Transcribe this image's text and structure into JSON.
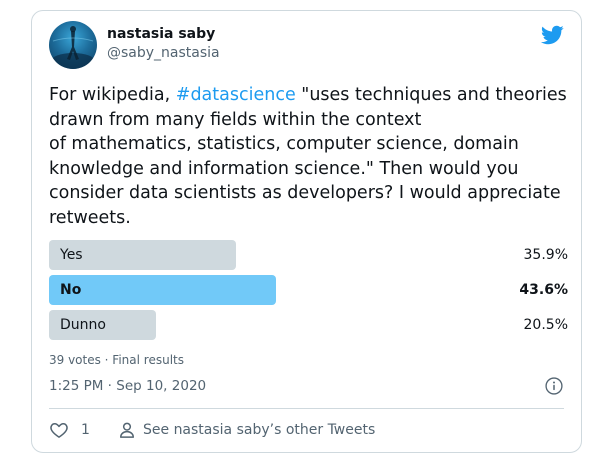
{
  "tweet": {
    "author": {
      "display_name": "nastasia saby",
      "handle": "@saby_nastasia"
    },
    "text_parts": {
      "before": "For wikipedia, ",
      "hashtag": "#datascience",
      "line1_rest": " \"uses techniques and theories",
      "line2": "drawn from many fields within the context",
      "line3": "of mathematics, statistics, computer science, domain",
      "line4": "knowledge and information science.\" Then would you",
      "line5": "consider data scientists as developers? I would appreciate",
      "line6": "retweets."
    },
    "poll": {
      "options": [
        {
          "label": "Yes",
          "percent_text": "35.9%",
          "percent": 35.9,
          "winner": false
        },
        {
          "label": "No",
          "percent_text": "43.6%",
          "percent": 43.6,
          "winner": true
        },
        {
          "label": "Dunno",
          "percent_text": "20.5%",
          "percent": 20.5,
          "winner": false
        }
      ],
      "meta": "39 votes · Final results"
    },
    "timestamp": "1:25 PM · Sep 10, 2020",
    "like_count": "1",
    "see_more_label": "See nastasia saby’s other Tweets"
  },
  "colors": {
    "brand": "#1d9bf0",
    "poll_winner": "#71c9f8",
    "poll_other": "#cfd9de",
    "secondary_text": "#536471"
  },
  "icons": [
    "twitter-bird-icon",
    "info-icon",
    "heart-icon",
    "person-icon"
  ]
}
